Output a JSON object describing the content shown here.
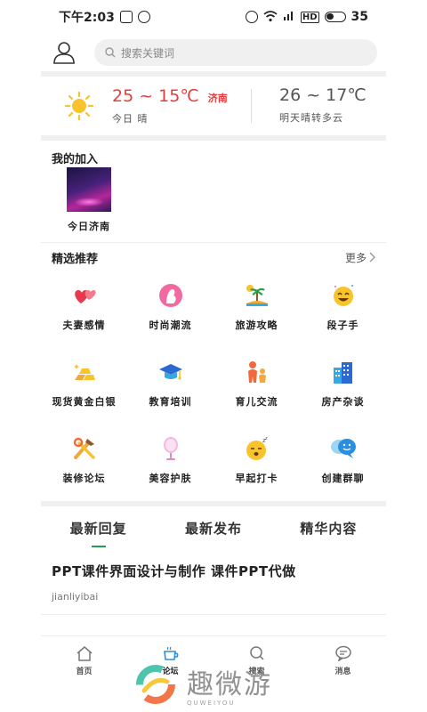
{
  "status_bar": {
    "time": "下午2:03",
    "battery": "35"
  },
  "header": {
    "search_placeholder": "搜索关键词"
  },
  "weather": {
    "today_temp": "25 ~ 15℃",
    "today_city": "济南",
    "today_desc": "今日 晴",
    "tomorrow_temp": "26 ~ 17℃",
    "tomorrow_desc": "明天晴转多云"
  },
  "joined": {
    "title": "我的加入",
    "items": [
      {
        "label": "今日济南"
      }
    ]
  },
  "recommend": {
    "title": "精选推荐",
    "more": "更多",
    "categories": [
      {
        "label": "夫妻感情",
        "icon": "hearts-icon"
      },
      {
        "label": "时尚潮流",
        "icon": "fashion-icon"
      },
      {
        "label": "旅游攻略",
        "icon": "island-icon"
      },
      {
        "label": "段子手",
        "icon": "laughing-face-icon"
      },
      {
        "label": "现货黄金白银",
        "icon": "gold-bars-icon"
      },
      {
        "label": "教育培训",
        "icon": "graduation-cap-icon"
      },
      {
        "label": "育儿交流",
        "icon": "parent-child-icon"
      },
      {
        "label": "房产杂谈",
        "icon": "building-icon"
      },
      {
        "label": "装修论坛",
        "icon": "tools-icon"
      },
      {
        "label": "美容护肤",
        "icon": "mirror-icon"
      },
      {
        "label": "早起打卡",
        "icon": "sleepy-face-icon"
      },
      {
        "label": "创建群聊",
        "icon": "chat-bubbles-icon"
      }
    ]
  },
  "tabs": [
    {
      "label": "最新回复",
      "active": true
    },
    {
      "label": "最新发布",
      "active": false
    },
    {
      "label": "精华内容",
      "active": false
    }
  ],
  "posts": [
    {
      "title": "PPT课件界面设计与制作  课件PPT代做",
      "author": "jianliyibai"
    }
  ],
  "bottom_nav": [
    {
      "label": "首页",
      "icon": "home-icon"
    },
    {
      "label": "论坛",
      "icon": "coffee-cup-icon",
      "active": true
    },
    {
      "label": "搜索",
      "icon": "search-icon"
    },
    {
      "label": "消息",
      "icon": "message-icon"
    }
  ],
  "watermark": {
    "main": "趣微游",
    "sub": "QUWEIYOU"
  },
  "colors": {
    "accent_red": "#e83c3c",
    "accent_green": "#2e9b4b"
  }
}
